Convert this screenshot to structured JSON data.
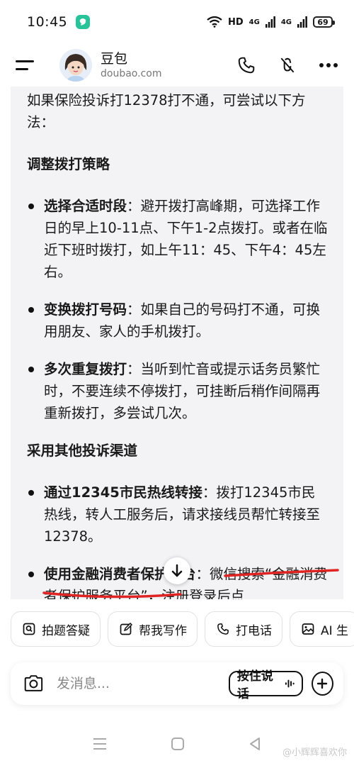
{
  "status_bar": {
    "time": "10:45",
    "network": "HD",
    "signal1_label": "4G",
    "signal2_label": "4G",
    "signal2_sub": "R",
    "battery": "69"
  },
  "header": {
    "bot_name": "豆包",
    "bot_domain": "doubao.com"
  },
  "message": {
    "intro": "如果保险投诉打12378打不通，可尝试以下方法：",
    "section1_title": "调整拨打策略",
    "section1_items": [
      {
        "title": "选择合适时段",
        "body": "：避开拨打高峰期，可选择工作日的早上10-11点、下午1-2点拨打。或者在临近下班时拨打，如上午11：45、下午4：45左右。"
      },
      {
        "title": "变换拨打号码",
        "body": "：如果自己的号码打不通，可换用朋友、家人的手机拨打。"
      },
      {
        "title": "多次重复拨打",
        "body": "：当听到忙音或提示话务员繁忙时，不要连续不停拨打，可挂断后稍作间隔再重新拨打，多尝试几次。"
      }
    ],
    "section2_title": "采用其他投诉渠道",
    "section2_items": [
      {
        "title": "通过12345市民热线转接",
        "body": "：拨打12345市民热线，转人工服务后，请求接线员帮忙转接至12378。"
      },
      {
        "title": "使用金融消费者保护平台",
        "body_a": "：",
        "body_hl": "微信搜索“金融消费者保护服务平台”",
        "body_b": "，注册登录后点"
      }
    ]
  },
  "chips": [
    {
      "icon": "photo-question-icon",
      "label": "拍题答疑"
    },
    {
      "icon": "pen-edit-icon",
      "label": "帮我写作"
    },
    {
      "icon": "phone-icon",
      "label": "打电话"
    },
    {
      "icon": "image-icon",
      "label": "AI 生"
    }
  ],
  "input": {
    "placeholder": "发消息...",
    "hold_to_talk": "按住说话"
  },
  "watermark": "@小辉辉喜欢你",
  "colors": {
    "card_bg": "#f3f3f5",
    "underline_red": "#e02424",
    "status_app_green": "#27c49a"
  }
}
